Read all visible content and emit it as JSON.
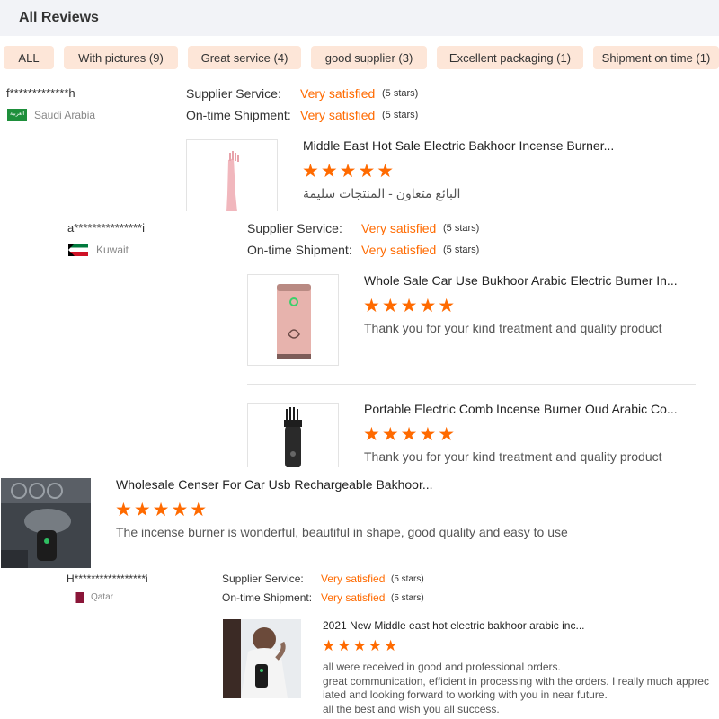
{
  "header": {
    "title": "All Reviews"
  },
  "filters": [
    {
      "label": "ALL"
    },
    {
      "label": "With pictures (9)"
    },
    {
      "label": "Great service (4)"
    },
    {
      "label": "good supplier (3)"
    },
    {
      "label": "Excellent packaging (1)"
    },
    {
      "label": "Shipment on time (1)"
    }
  ],
  "reviews": [
    {
      "buyer": "f*************h",
      "country": "Saudi Arabia",
      "ratings": [
        {
          "label": "Supplier Service:",
          "value": "Very satisfied",
          "stars_text": "(5 stars)"
        },
        {
          "label": "On-time Shipment:",
          "value": "Very satisfied",
          "stars_text": "(5 stars)"
        }
      ],
      "products": [
        {
          "title": "Middle East Hot Sale Electric Bakhoor Incense Burner...",
          "stars": "★★★★★",
          "comment": "البائع متعاون - المنتجات سليمة"
        }
      ]
    },
    {
      "buyer": "a***************i",
      "country": "Kuwait",
      "ratings": [
        {
          "label": "Supplier Service:",
          "value": "Very satisfied",
          "stars_text": "(5 stars)"
        },
        {
          "label": "On-time Shipment:",
          "value": "Very satisfied",
          "stars_text": "(5 stars)"
        }
      ],
      "products": [
        {
          "title": "Whole Sale Car Use Bukhoor Arabic Electric Burner In...",
          "stars": "★★★★★",
          "comment": "Thank you for your kind treatment and quality product"
        },
        {
          "title": "Portable Electric Comb Incense Burner Oud Arabic Co...",
          "stars": "★★★★★",
          "comment": "Thank you for your kind treatment and quality product"
        }
      ]
    },
    {
      "products": [
        {
          "title": "Wholesale Censer For Car Usb Rechargeable Bakhoor...",
          "stars": "★★★★★",
          "comment": "The incense burner is wonderful, beautiful in shape, good quality and easy to use"
        }
      ]
    },
    {
      "buyer": "H*****************i",
      "country": "Qatar",
      "ratings": [
        {
          "label": "Supplier Service:",
          "value": "Very satisfied",
          "stars_text": "(5 stars)"
        },
        {
          "label": "On-time Shipment:",
          "value": "Very satisfied",
          "stars_text": "(5 stars)"
        }
      ],
      "products": [
        {
          "title": "2021 New Middle east hot electric bakhoor arabic inc...",
          "stars": "★★★★★",
          "comment_lines": [
            "all were received in good and professional orders.",
            "great communication, efficient in processing with the orders. I really much apprec",
            "iated and looking forward to working with you in near future.",
            "all the best and wish you all success."
          ]
        }
      ]
    }
  ],
  "colors": {
    "accent": "#ff6a00",
    "chip_bg": "#fde6d8",
    "header_bg": "#f2f3f7"
  }
}
